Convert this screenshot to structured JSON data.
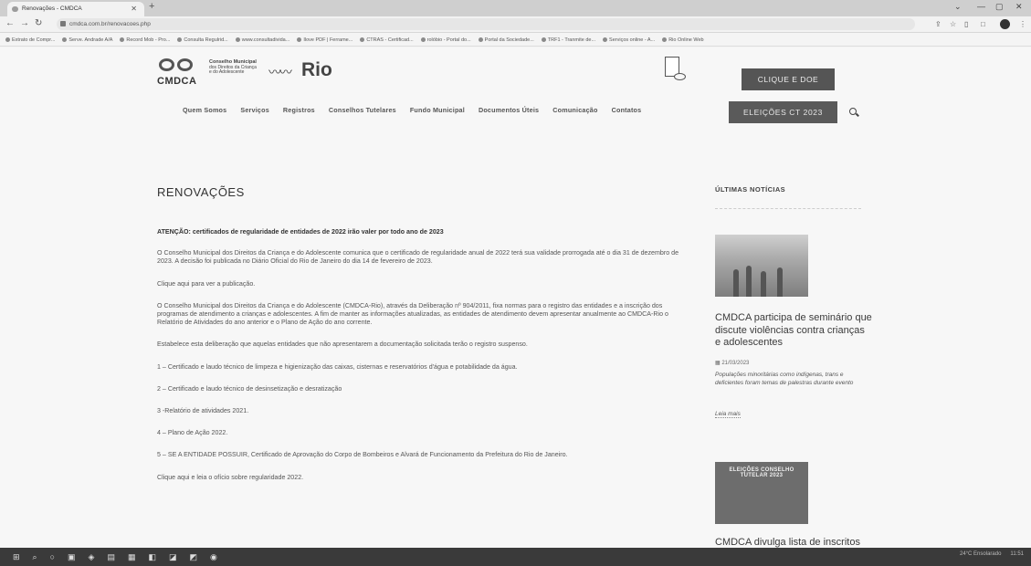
{
  "browser": {
    "tab_title": "Renovações - CMDCA",
    "url": "cmdca.com.br/renovacoes.php",
    "bookmarks": [
      "Extrato de Compr...",
      "Serve. Andrade A/A",
      "Record Mob - Pro...",
      "Consulta Regulrid...",
      "www.consultadivida...",
      "Ilove PDF | Ferrame...",
      "CTRAS - Certificad...",
      "rolóbio - Portal do...",
      "Portal da Sociedade...",
      "TRF1 - Tranmite de...",
      "Serviços online - A...",
      "Rio Online Web"
    ]
  },
  "header": {
    "logo_text": "CMDCA",
    "logo_small_lines": [
      "Conselho Municipal",
      "dos Direitos da Criança",
      "e do Adolescente"
    ],
    "logo_rio": "Rio",
    "cta_donate": "CLIQUE E DOE",
    "menu": [
      "Quem Somos",
      "Serviços",
      "Registros",
      "Conselhos Tutelares",
      "Fundo Municipal",
      "Documentos Úteis",
      "Comunicação",
      "Contatos"
    ],
    "cta_elections": "ELEIÇÕES CT 2023"
  },
  "main": {
    "title": "RENOVAÇÕES",
    "paragraphs": [
      "ATENÇÃO: certificados de regularidade de entidades de 2022 irão valer por todo ano de 2023",
      "O Conselho Municipal dos Direitos da Criança e do Adolescente comunica que o certificado de regularidade anual de 2022 terá sua validade prorrogada até o dia 31 de dezembro de 2023. A decisão foi publicada no Diário Oficial do Rio de Janeiro do dia 14 de fevereiro de 2023.",
      "Clique aqui para ver a publicação.",
      "O Conselho Municipal dos Direitos da Criança e do Adolescente (CMDCA-Rio), através da Deliberação nº 904/2011, fixa normas para o registro das entidades e a inscrição dos programas de atendimento a crianças e adolescentes. A fim de manter as informações atualizadas, as entidades de atendimento devem apresentar anualmente ao CMDCA-Rio o Relatório de Atividades do ano anterior e o Plano de Ação do ano corrente.",
      "Estabelece esta deliberação que aquelas entidades que não apresentarem a documentação solicitada terão o registro suspenso.",
      "1 – Certificado e laudo técnico de limpeza e higienização das caixas, cisternas e reservatórios d'água e potabilidade da água.",
      "2 – Certificado e laudo técnico de desinsetização e desratização",
      "3 -Relatório de atividades 2021.",
      "4 – Plano de Ação 2022.",
      "5 – SE A ENTIDADE POSSUIR, Certificado de Aprovação do Corpo de Bombeiros e Alvará de Funcionamento da Prefeitura do Rio de Janeiro.",
      "Clique aqui e leia o ofício sobre regularidade 2022."
    ]
  },
  "sidebar": {
    "title": "ÚLTIMAS NOTÍCIAS",
    "news1_title": "CMDCA participa de seminário que discute violências contra crianças e adolescentes",
    "news1_date": "21/03/2023",
    "news1_excerpt": "Populações minoritárias como indígenas, trans e deficientes foram temas de palestras durante evento",
    "read_more": "Leia mais",
    "news2_thumb_title": "ELEIÇÕES CONSELHO TUTELAR 2023",
    "news2_title": "CMDCA divulga lista de inscritos"
  },
  "taskbar": {
    "weather": "24°C Ensolarado",
    "time": "11:51"
  }
}
